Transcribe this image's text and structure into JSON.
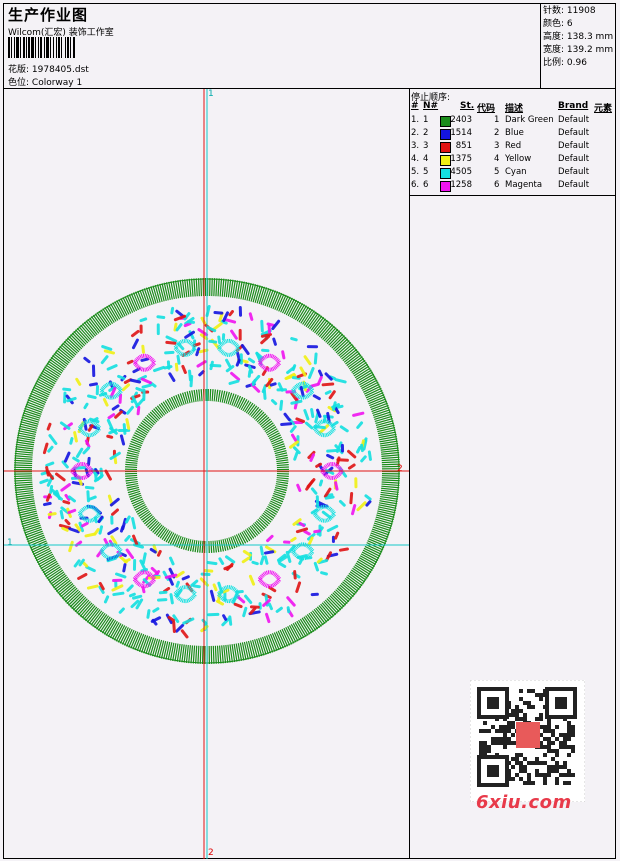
{
  "header": {
    "title": "生产作业图",
    "company": "Wilcom(汇宏) 装饰工作室",
    "design_file_label": "花版:",
    "design_file": "1978405.dst",
    "colorway_label": "色位:",
    "colorway": "Colorway 1"
  },
  "stats": {
    "stitches_label": "针数:",
    "stitches": "11908",
    "colors_label": "颜色:",
    "colors": "6",
    "height_label": "高度:",
    "height": "138.3 mm",
    "width_label": "宽度:",
    "width": "139.2 mm",
    "scale_label": "比例:",
    "scale": "0.96"
  },
  "stop_sequence": {
    "label": "停止顺序:",
    "columns": [
      "#",
      "N#",
      "St.",
      "代码",
      "描述",
      "Brand",
      "元素"
    ],
    "rows": [
      {
        "idx": "1.",
        "n": "1",
        "color": "#1a8c1a",
        "st": "2403",
        "code": "1",
        "desc": "Dark Green",
        "brand": "Default"
      },
      {
        "idx": "2.",
        "n": "2",
        "color": "#1414e0",
        "st": "1514",
        "code": "2",
        "desc": "Blue",
        "brand": "Default"
      },
      {
        "idx": "3.",
        "n": "3",
        "color": "#e01414",
        "st": "851",
        "code": "3",
        "desc": "Red",
        "brand": "Default"
      },
      {
        "idx": "4.",
        "n": "4",
        "color": "#f0f014",
        "st": "1375",
        "code": "4",
        "desc": "Yellow",
        "brand": "Default"
      },
      {
        "idx": "5.",
        "n": "5",
        "color": "#14e0e0",
        "st": "4505",
        "code": "5",
        "desc": "Cyan",
        "brand": "Default"
      },
      {
        "idx": "6.",
        "n": "6",
        "color": "#f014f0",
        "st": "1258",
        "code": "6",
        "desc": "Magenta",
        "brand": "Default"
      }
    ]
  },
  "markers": {
    "top": "1",
    "bottom": "2",
    "left": "1",
    "right": "2"
  },
  "watermark": {
    "brand": "6xiu.com"
  }
}
